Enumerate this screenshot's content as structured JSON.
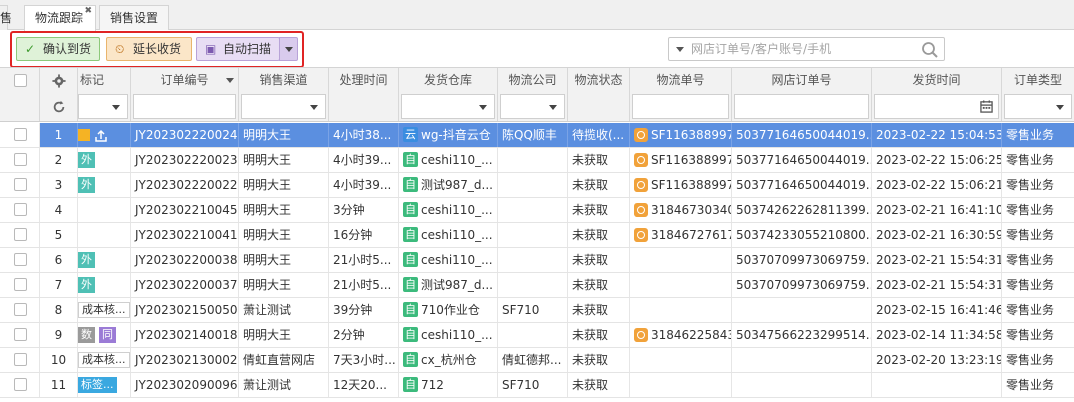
{
  "tabs": {
    "cut": "售",
    "active": "物流跟踪",
    "other": "销售设置",
    "close": "✖"
  },
  "toolbar": {
    "confirm": "确认到货",
    "extend": "延长收货",
    "scan": "自动扫描",
    "confirm_icon": "✓",
    "extend_icon": "⏲",
    "scan_icon": "▣"
  },
  "search": {
    "placeholder": "网店订单号/客户账号/手机"
  },
  "columns": {
    "mark": "标记",
    "order_no": "订单编号",
    "channel": "销售渠道",
    "process_time": "处理时间",
    "warehouse": "发货仓库",
    "logistics_company": "物流公司",
    "logistics_status": "物流状态",
    "tracking_no": "物流单号",
    "shop_order_no": "网店订单号",
    "ship_time": "发货时间",
    "order_type": "订单类型"
  },
  "rows": [
    {
      "no": "1",
      "tag": "",
      "tag2": "",
      "order": "JY202302220024",
      "channel": "明明大王",
      "ptime": "4小时38...",
      "wh_icon": "云",
      "wh": "wg-抖音云仓",
      "lc": "陈QQ顺丰",
      "ls": "待揽收(...",
      "trk": "SF116388997",
      "shop": "50377164650044019...",
      "stime": "2023-02-22 15:04:53",
      "otype": "零售业务"
    },
    {
      "no": "2",
      "tag": "外",
      "tag2": "",
      "order": "JY202302220023",
      "channel": "明明大王",
      "ptime": "4小时39...",
      "wh_icon": "自",
      "wh": "ceshi110_...",
      "lc": "",
      "ls": "未获取",
      "trk": "SF116388997",
      "shop": "50377164650044019...",
      "stime": "2023-02-22 15:06:25",
      "otype": "零售业务"
    },
    {
      "no": "3",
      "tag": "外",
      "tag2": "",
      "order": "JY202302220022",
      "channel": "明明大王",
      "ptime": "4小时39...",
      "wh_icon": "自",
      "wh": "测试987_d...",
      "lc": "",
      "ls": "未获取",
      "trk": "SF116388997",
      "shop": "50377164650044019...",
      "stime": "2023-02-22 15:06:21",
      "otype": "零售业务"
    },
    {
      "no": "4",
      "tag": "",
      "tag2": "",
      "order": "JY202302210045",
      "channel": "明明大王",
      "ptime": "3分钟",
      "wh_icon": "自",
      "wh": "ceshi110_...",
      "lc": "",
      "ls": "未获取",
      "trk": "31846730340",
      "shop": "50374262262811399...",
      "stime": "2023-02-21 16:41:10",
      "otype": "零售业务"
    },
    {
      "no": "5",
      "tag": "",
      "tag2": "",
      "order": "JY202302210041",
      "channel": "明明大王",
      "ptime": "16分钟",
      "wh_icon": "自",
      "wh": "ceshi110_...",
      "lc": "",
      "ls": "未获取",
      "trk": "31846727617",
      "shop": "50374233055210800...",
      "stime": "2023-02-21 16:30:59",
      "otype": "零售业务"
    },
    {
      "no": "6",
      "tag": "外",
      "tag2": "",
      "order": "JY202302200038",
      "channel": "明明大王",
      "ptime": "21小时5...",
      "wh_icon": "自",
      "wh": "ceshi110_...",
      "lc": "",
      "ls": "未获取",
      "trk": "",
      "shop": "50370709973069759...",
      "stime": "2023-02-21 15:54:31",
      "otype": "零售业务"
    },
    {
      "no": "7",
      "tag": "外",
      "tag2": "",
      "order": "JY202302200037",
      "channel": "明明大王",
      "ptime": "21小时5...",
      "wh_icon": "自",
      "wh": "测试987_d...",
      "lc": "",
      "ls": "未获取",
      "trk": "",
      "shop": "50370709973069759...",
      "stime": "2023-02-21 15:54:31",
      "otype": "零售业务"
    },
    {
      "no": "8",
      "tag": "成本核...",
      "tag2": "",
      "order": "JY202302150050",
      "channel": "萧让测试",
      "ptime": "39分钟",
      "wh_icon": "自",
      "wh": "710作业仓",
      "lc": "SF710",
      "ls": "未获取",
      "trk": "",
      "shop": "",
      "stime": "2023-02-15 16:41:46",
      "otype": "零售业务"
    },
    {
      "no": "9",
      "tag": "数",
      "tag2": "同",
      "order": "JY202302140018",
      "channel": "明明大王",
      "ptime": "2分钟",
      "wh_icon": "自",
      "wh": "ceshi110_...",
      "lc": "",
      "ls": "未获取",
      "trk": "31846225843",
      "shop": "50347566223299514...",
      "stime": "2023-02-14 11:34:58",
      "otype": "零售业务"
    },
    {
      "no": "10",
      "tag": "成本核...",
      "tag2": "",
      "order": "JY202302130002",
      "channel": "倩虹直营网店",
      "ptime": "7天3小时...",
      "wh_icon": "自",
      "wh": "cx_杭州仓",
      "lc": "倩虹德邦...",
      "ls": "未获取",
      "trk": "",
      "shop": "",
      "stime": "2023-02-20 13:23:19",
      "otype": "零售业务"
    },
    {
      "no": "11",
      "tag": "标签...",
      "tag2": "",
      "order": "JY202302090096",
      "channel": "萧让测试",
      "ptime": "12天20...",
      "wh_icon": "自",
      "wh": "712",
      "lc": "SF710",
      "ls": "未获取",
      "trk": "",
      "shop": "",
      "stime": "",
      "otype": "零售业务"
    }
  ],
  "colors": {
    "selected_row": "#5b8fe0",
    "highlight_box": "#e02424"
  }
}
